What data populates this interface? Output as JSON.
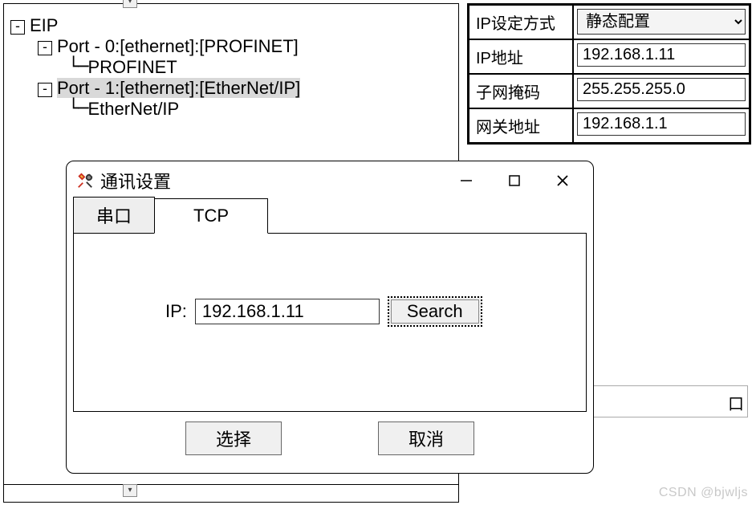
{
  "tree": {
    "root": "EIP",
    "port0": "Port - 0:[ethernet]:[PROFINET]",
    "port0_child": "PROFINET",
    "port1": "Port - 1:[ethernet]:[EtherNet/IP]",
    "port1_child": "EtherNet/IP"
  },
  "props": {
    "rows": [
      {
        "label": "IP设定方式",
        "value": "静态配置",
        "type": "select"
      },
      {
        "label": "IP地址",
        "value": "192.168.1.11",
        "type": "text"
      },
      {
        "label": "子网掩码",
        "value": "255.255.255.0",
        "type": "text"
      },
      {
        "label": "网关地址",
        "value": "192.168.1.1",
        "type": "text"
      }
    ]
  },
  "dialog": {
    "title": "通讯设置",
    "tabs": {
      "serial": "串口",
      "tcp": "TCP"
    },
    "ip_label": "IP:",
    "ip_value": "192.168.1.11",
    "search": "Search",
    "ok": "选择",
    "cancel": "取消"
  },
  "watermark": "CSDN @bjwljs"
}
